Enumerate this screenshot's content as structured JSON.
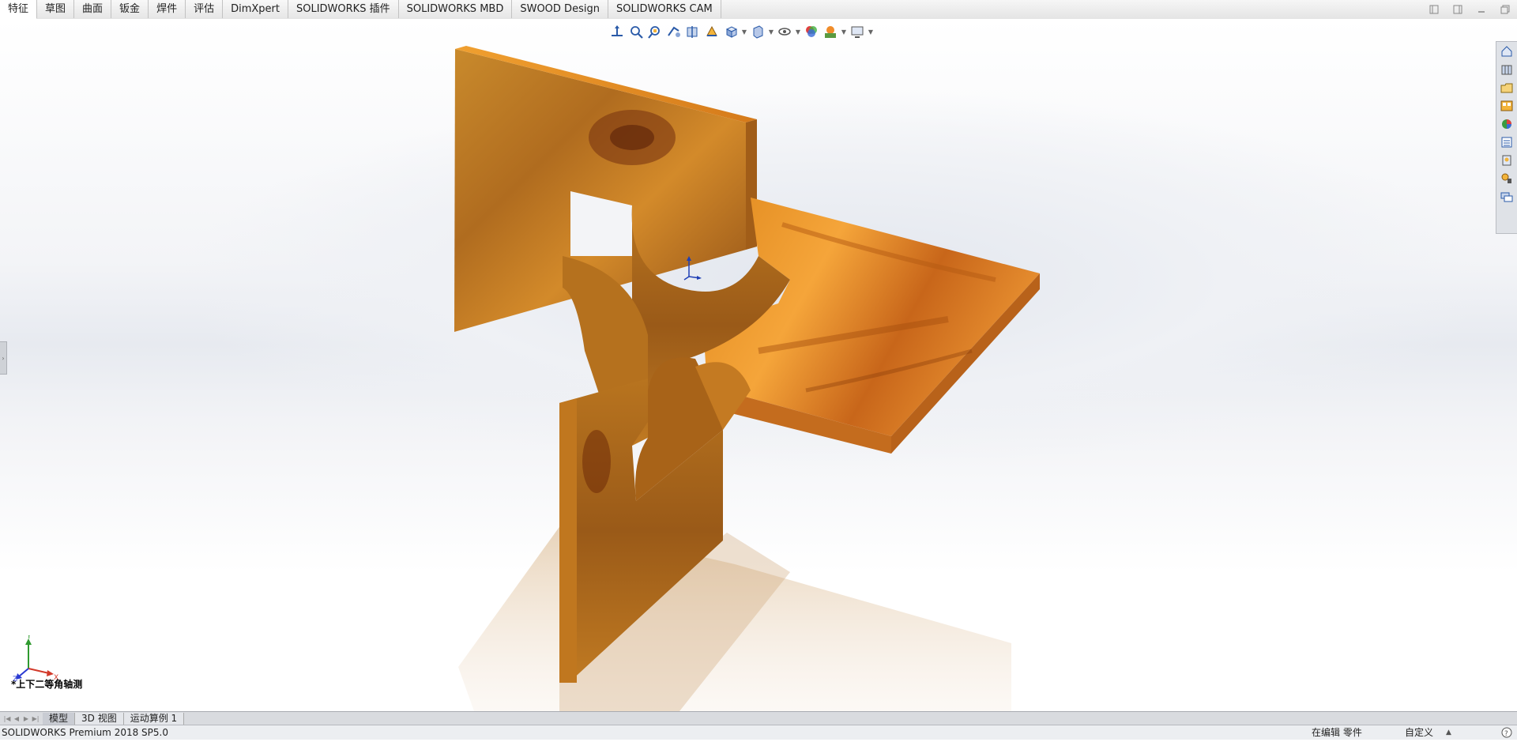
{
  "command_tabs": [
    {
      "id": "features",
      "label": "特征",
      "active": true
    },
    {
      "id": "sketch",
      "label": "草图"
    },
    {
      "id": "surfaces",
      "label": "曲面"
    },
    {
      "id": "sheetmetal",
      "label": "钣金"
    },
    {
      "id": "weldments",
      "label": "焊件"
    },
    {
      "id": "evaluate",
      "label": "评估"
    },
    {
      "id": "dimxpert",
      "label": "DimXpert"
    },
    {
      "id": "addins",
      "label": "SOLIDWORKS 插件"
    },
    {
      "id": "mbd",
      "label": "SOLIDWORKS MBD"
    },
    {
      "id": "swood",
      "label": "SWOOD Design"
    },
    {
      "id": "cam",
      "label": "SOLIDWORKS CAM"
    }
  ],
  "viewport": {
    "view_orientation": "*上下二等角轴测",
    "triad_labels": {
      "x": "X",
      "y": "Y",
      "z": "Z"
    },
    "model_colors": {
      "light": "#f2a23a",
      "mid": "#d7801f",
      "dark": "#8a4412"
    }
  },
  "hud_icons": [
    "view-orientation-icon",
    "zoom-to-fit-icon",
    "zoom-area-icon",
    "previous-view-icon",
    "section-view-icon",
    "view-selector-icon",
    "display-style-icon",
    "hide-show-icon",
    "edit-appearance-icon",
    "apply-scene-icon",
    "view-settings-icon"
  ],
  "task_pane_icons": [
    "solidworks-resources-icon",
    "design-library-icon",
    "file-explorer-icon",
    "view-palette-icon",
    "appearances-icon",
    "custom-properties-icon",
    "solidworks-forum-icon",
    "3d-content-icon",
    "chat-icon"
  ],
  "bottom_tabs": [
    {
      "label": "模型",
      "active": true
    },
    {
      "label": "3D 视图"
    },
    {
      "label": "运动算例 1"
    }
  ],
  "status": {
    "product": "SOLIDWORKS Premium 2018 SP5.0",
    "editing": "在编辑 零件",
    "units": "自定义"
  }
}
